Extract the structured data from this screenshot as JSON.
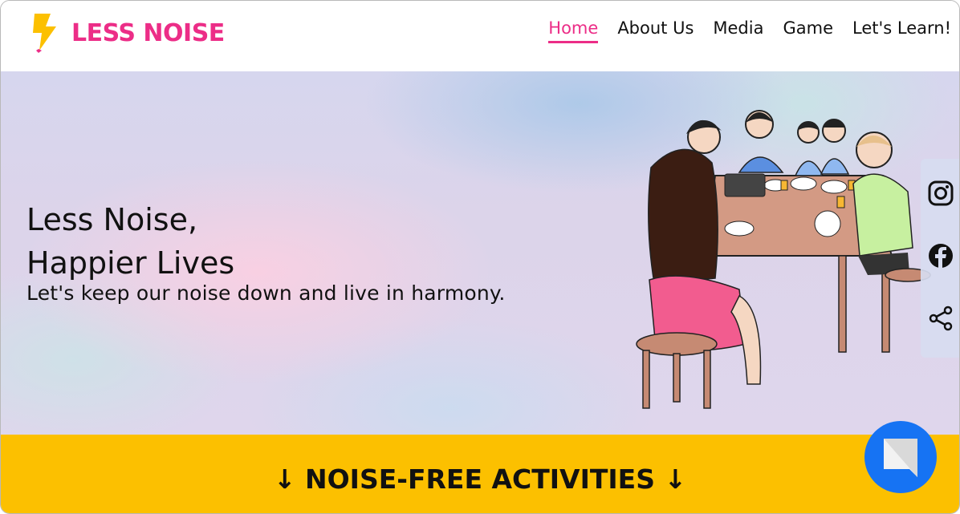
{
  "brand": {
    "name": "LESS NOISE",
    "accent": "#ec2d87",
    "logo_color": "#fcc000"
  },
  "nav": {
    "items": [
      {
        "label": "Home",
        "active": true
      },
      {
        "label": "About Us",
        "active": false
      },
      {
        "label": "Media",
        "active": false
      },
      {
        "label": "Game",
        "active": false
      },
      {
        "label": "Let's Learn!",
        "active": false
      }
    ]
  },
  "hero": {
    "title_line1": "Less Noise,",
    "title_line2": "Happier Lives",
    "subtitle": "Let's keep our noise down and live in harmony."
  },
  "social": [
    "instagram-icon",
    "facebook-icon",
    "share-icon"
  ],
  "activities": {
    "heading": "↓ NOISE-FREE ACTIVITIES ↓",
    "bar_color": "#fcc000"
  },
  "chat": {
    "icon": "chat-icon",
    "color": "#1673f3"
  }
}
